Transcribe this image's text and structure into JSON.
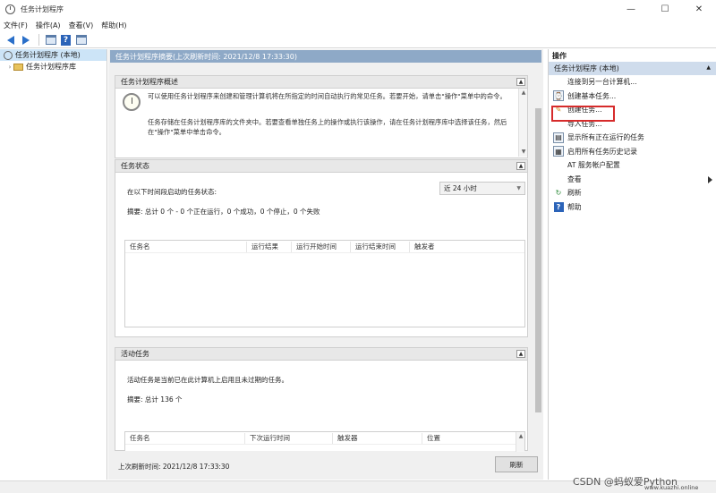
{
  "window": {
    "title": "任务计划程序",
    "min": "—",
    "max": "☐",
    "close": "✕"
  },
  "menu": [
    "文件(F)",
    "操作(A)",
    "查看(V)",
    "帮助(H)"
  ],
  "tree": {
    "root": "任务计划程序 (本地)",
    "child": "任务计划程序库"
  },
  "center": {
    "header": "任务计划程序摘要(上次刷新时间: 2021/12/8 17:33:30)",
    "overview": {
      "title": "任务计划程序概述",
      "p1": "可以使用任务计划程序来创建和管理计算机将在所指定的时间自动执行的常见任务。若要开始，请单击\"操作\"菜单中的命令。",
      "p2": "任务存储在任务计划程序库的文件夹中。若要查看单独任务上的操作或执行该操作，请在任务计划程序库中选择该任务，然后在\"操作\"菜单中单击命令。"
    },
    "status": {
      "title": "任务状态",
      "label": "在以下时间段启动的任务状态:",
      "period": "近 24 小时",
      "summary": "摘要: 总计 0 个 - 0 个正在运行，0 个成功，0 个停止，0 个失败",
      "columns": [
        "任务名",
        "运行结果",
        "运行开始时间",
        "运行结束时间",
        "触发者"
      ]
    },
    "active": {
      "title": "活动任务",
      "desc": "活动任务是当前已在此计算机上启用且未过期的任务。",
      "summary": "摘要: 总计 136 个",
      "columns": [
        "任务名",
        "下次运行时间",
        "触发器",
        "位置"
      ]
    },
    "footer": {
      "last_refresh": "上次刷新时间: 2021/12/8 17:33:30",
      "refresh_btn": "刷新"
    }
  },
  "actions": {
    "title": "操作",
    "group": "任务计划程序 (本地)",
    "items": [
      {
        "label": "连接到另一台计算机...",
        "icon": ""
      },
      {
        "label": "创建基本任务...",
        "icon": "basic-task-icon"
      },
      {
        "label": "创建任务...",
        "icon": "create-task-icon"
      },
      {
        "label": "导入任务...",
        "icon": ""
      },
      {
        "label": "显示所有正在运行的任务",
        "icon": "running-tasks-icon"
      },
      {
        "label": "启用所有任务历史记录",
        "icon": "history-icon"
      },
      {
        "label": "AT 服务帐户配置",
        "icon": ""
      },
      {
        "label": "查看",
        "icon": ""
      },
      {
        "label": "刷新",
        "icon": "refresh-icon"
      },
      {
        "label": "帮助",
        "icon": "help-icon"
      }
    ]
  },
  "watermark": "CSDN @蚂蚁爱Python",
  "watermark_site": "www.kuazhi.online",
  "colors": {
    "highlight": "#d62b2b",
    "header": "#8ea9c7",
    "selection": "#cce4f7",
    "group": "#cfdcec"
  }
}
